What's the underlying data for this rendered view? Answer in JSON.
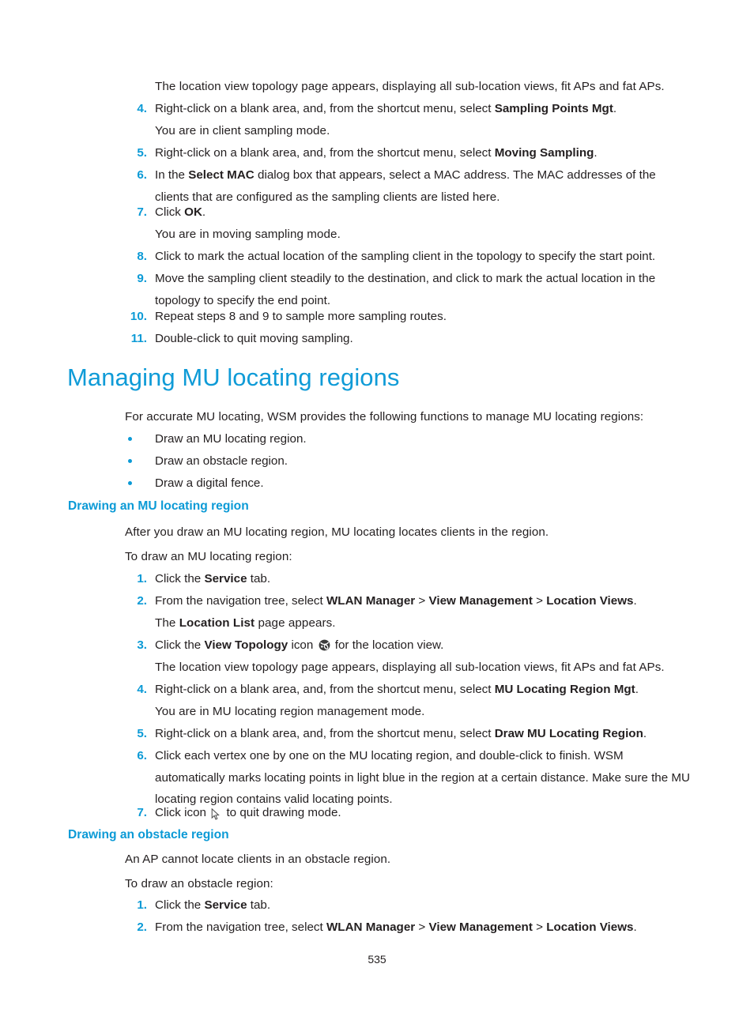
{
  "page": {
    "number": "535",
    "accent_color": "#0b9ad6",
    "heading_color": "#0f9bd7",
    "body_color": "#231f20"
  },
  "top_list": {
    "intro": "The location view topology page appears, displaying all sub-location views, fit APs and fat APs.",
    "items": [
      {
        "num": "4.",
        "text_pre": "Right-click on a blank area, and, from the shortcut menu, select ",
        "bold": "Sampling Points Mgt",
        "text_post": ".",
        "follow": "You are in client sampling mode."
      },
      {
        "num": "5.",
        "text_pre": "Right-click on a blank area, and, from the shortcut menu, select ",
        "bold": "Moving Sampling",
        "text_post": "."
      },
      {
        "num": "6.",
        "text_pre": "In the ",
        "bold": "Select MAC",
        "text_post": " dialog box that appears, select a MAC address. The MAC addresses of the clients that are configured as the sampling clients are listed here."
      },
      {
        "num": "7.",
        "text_pre": "Click ",
        "bold": "OK",
        "text_post": ".",
        "follow": "You are in moving sampling mode."
      },
      {
        "num": "8.",
        "text_pre": "Click to mark the actual location of the sampling client in the topology to specify the start point.",
        "bold": "",
        "text_post": ""
      },
      {
        "num": "9.",
        "text_pre": "Move the sampling client steadily to the destination, and click to mark the actual location in the topology to specify the end point.",
        "bold": "",
        "text_post": ""
      },
      {
        "num": "10.",
        "text_pre": "Repeat steps 8 and 9 to sample more sampling routes.",
        "bold": "",
        "text_post": ""
      },
      {
        "num": "11.",
        "text_pre": "Double-click to quit moving sampling.",
        "bold": "",
        "text_post": ""
      }
    ]
  },
  "section": {
    "title": "Managing MU locating regions",
    "intro": "For accurate MU locating, WSM provides the following functions to manage MU locating regions:",
    "bullets": [
      "Draw an MU locating region.",
      "Draw an obstacle region.",
      "Draw a digital fence."
    ]
  },
  "mu_region": {
    "heading": "Drawing an MU locating region",
    "intro1": "After you draw an MU locating region, MU locating locates clients in the region.",
    "intro2": "To draw an MU locating region:",
    "steps": [
      {
        "num": "1.",
        "pre": "Click the ",
        "bold": "Service",
        "post": " tab."
      },
      {
        "num": "2.",
        "pre": "From the navigation tree, select ",
        "bold": "WLAN Manager",
        "mid1": " > ",
        "bold2": "View Management",
        "mid2": " > ",
        "bold3": "Location Views",
        "post": ".",
        "follow_pre": "The ",
        "follow_bold": "Location List",
        "follow_post": " page appears."
      },
      {
        "num": "3.",
        "pre": "Click the ",
        "bold": "View Topology",
        "post_icon": " icon ",
        "post": " for the location view.",
        "icon": "view-topology-icon",
        "follow": "The location view topology page appears, displaying all sub-location views, fit APs and fat APs."
      },
      {
        "num": "4.",
        "pre": "Right-click on a blank area, and, from the shortcut menu, select ",
        "bold": "MU Locating Region Mgt",
        "post": ".",
        "follow": "You are in MU locating region management mode."
      },
      {
        "num": "5.",
        "pre": "Right-click on a blank area, and, from the shortcut menu, select ",
        "bold": "Draw MU Locating Region",
        "post": "."
      },
      {
        "num": "6.",
        "pre": "Click each vertex one by one on the MU locating region, and double-click to finish. WSM automatically marks locating points in light blue in the region at a certain distance. Make sure the MU locating region contains valid locating points.",
        "bold": "",
        "post": ""
      },
      {
        "num": "7.",
        "pre": "Click icon ",
        "post": " to quit drawing mode.",
        "icon": "mouse-cursor-icon"
      }
    ]
  },
  "obstacle_region": {
    "heading": "Drawing an obstacle region",
    "intro1": "An AP cannot locate clients in an obstacle region.",
    "intro2": "To draw an obstacle region:",
    "steps": [
      {
        "num": "1.",
        "pre": "Click the ",
        "bold": "Service",
        "post": " tab."
      },
      {
        "num": "2.",
        "pre": "From the navigation tree, select ",
        "bold": "WLAN Manager",
        "mid1": " > ",
        "bold2": "View Management",
        "mid2": " > ",
        "bold3": "Location Views",
        "post": "."
      }
    ]
  }
}
